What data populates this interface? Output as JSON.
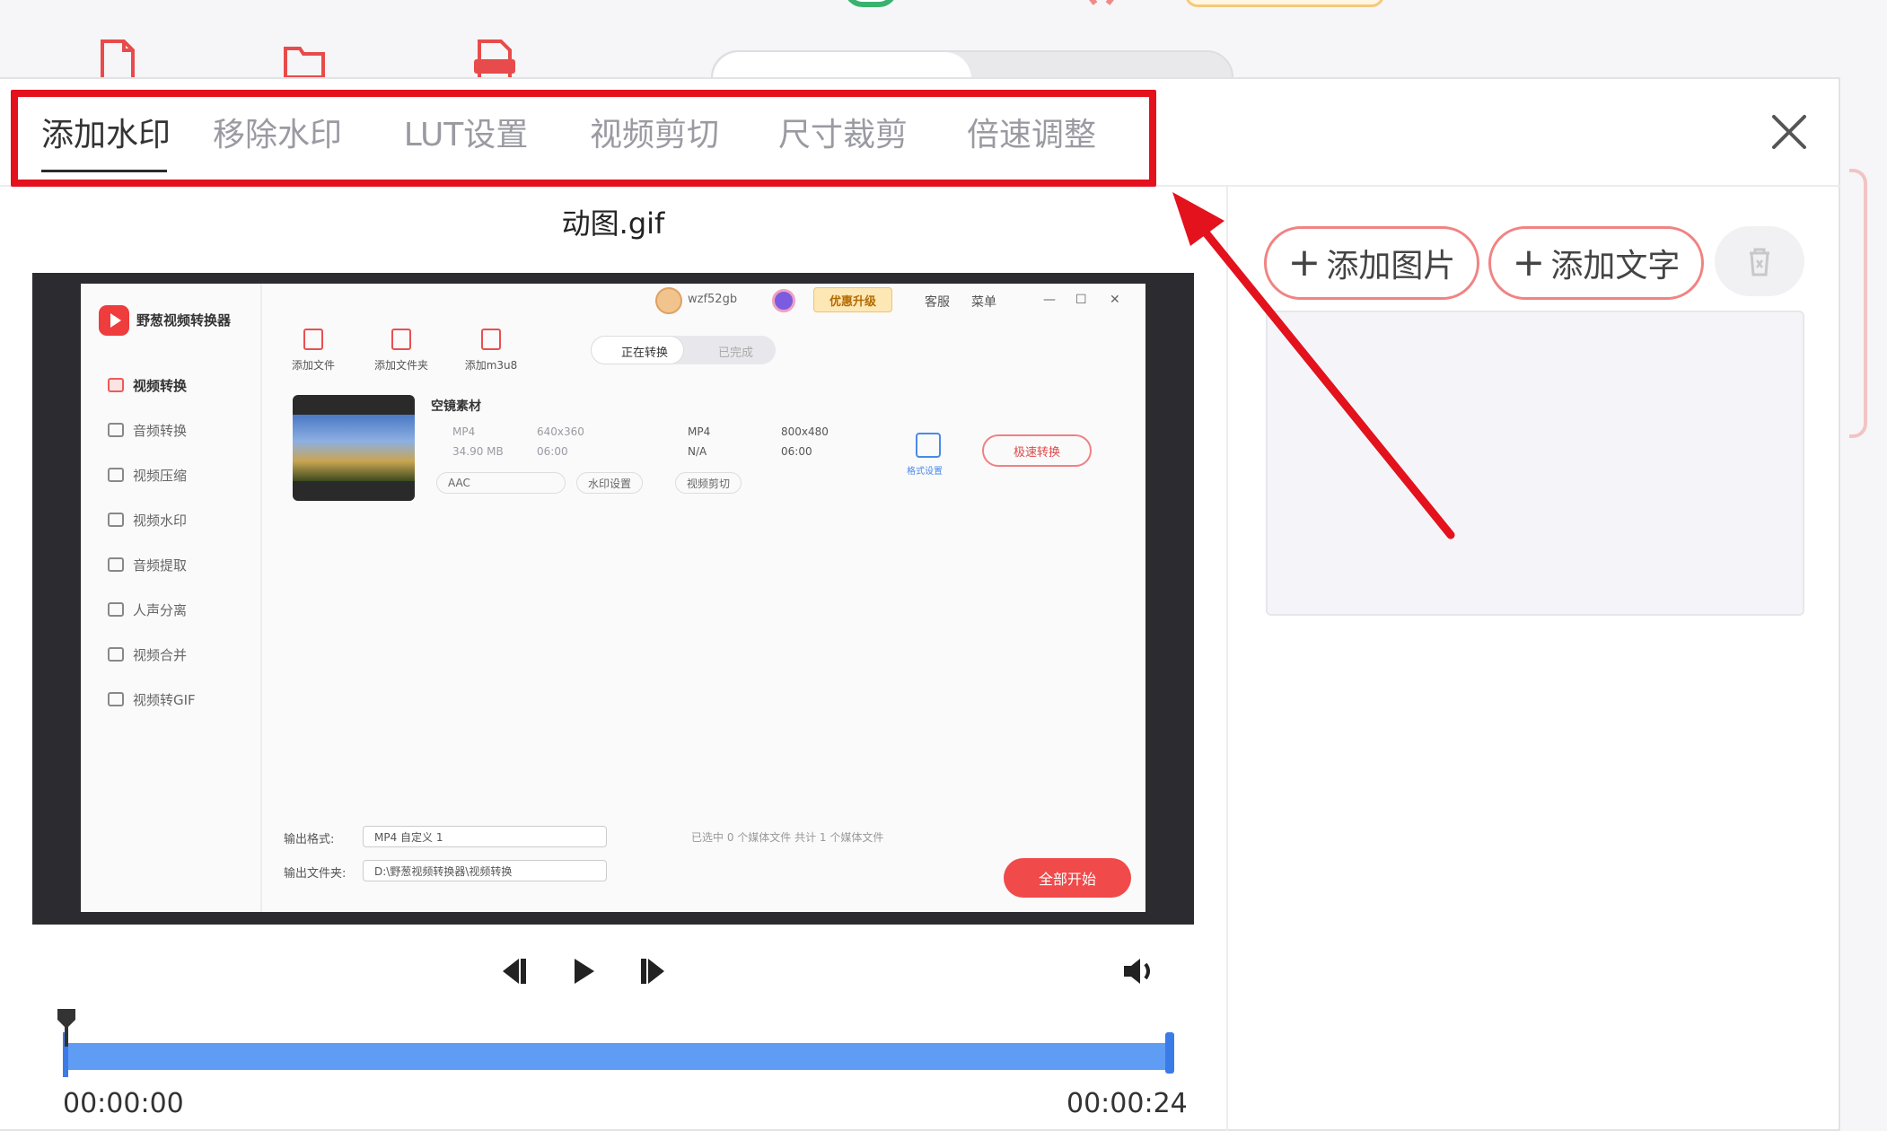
{
  "dialog": {
    "tabs": [
      {
        "label": "添加水印",
        "active": true
      },
      {
        "label": "移除水印",
        "active": false
      },
      {
        "label": "LUT设置",
        "active": false
      },
      {
        "label": "视频剪切",
        "active": false
      },
      {
        "label": "尺寸裁剪",
        "active": false
      },
      {
        "label": "倍速调整",
        "active": false
      }
    ],
    "file_name": "动图.gif"
  },
  "preview_app": {
    "app_name": "野葱视频转换器",
    "user": "wzf52gb",
    "vip_label": "优惠升级",
    "service_label": "客服",
    "menu_label": "菜单",
    "window_controls": [
      "—",
      "☐",
      "✕"
    ],
    "nav": [
      {
        "label": "视频转换",
        "active": true
      },
      {
        "label": "音频转换",
        "active": false
      },
      {
        "label": "视频压缩",
        "active": false
      },
      {
        "label": "视频水印",
        "active": false
      },
      {
        "label": "音频提取",
        "active": false
      },
      {
        "label": "人声分离",
        "active": false
      },
      {
        "label": "视频合并",
        "active": false
      },
      {
        "label": "视频转GIF",
        "active": false
      }
    ],
    "toolbar": [
      "添加文件",
      "添加文件夹",
      "添加m3u8"
    ],
    "segment": {
      "on": "正在转换",
      "off": "已完成"
    },
    "item": {
      "title": "空镜素材",
      "src_format": "MP4",
      "src_resolution": "640x360",
      "src_size": "34.90 MB",
      "src_duration": "06:00",
      "dst_format": "MP4",
      "dst_resolution": "800x480",
      "dst_size": "N/A",
      "dst_duration": "06:00",
      "audio": "AAC",
      "watermark_btn": "水印设置",
      "cut_btn": "视频剪切",
      "format_settings": "格式设置",
      "fast_convert": "极速转换"
    },
    "bottom": {
      "output_format_label": "输出格式:",
      "output_format_value": "MP4 自定义 1",
      "output_folder_label": "输出文件夹:",
      "output_folder_value": "D:\\野葱视频转换器\\视频转换",
      "status_text": "已选中 0 个媒体文件    共计 1 个媒体文件",
      "start_all": "全部开始"
    }
  },
  "player": {
    "time_start": "00:00:00",
    "time_end": "00:00:24"
  },
  "right_panel": {
    "add_image": "添加图片",
    "add_text": "添加文字"
  },
  "colors": {
    "highlight_red": "#e3121d",
    "timeline_blue": "#5f9df5",
    "button_border": "#f18383"
  }
}
